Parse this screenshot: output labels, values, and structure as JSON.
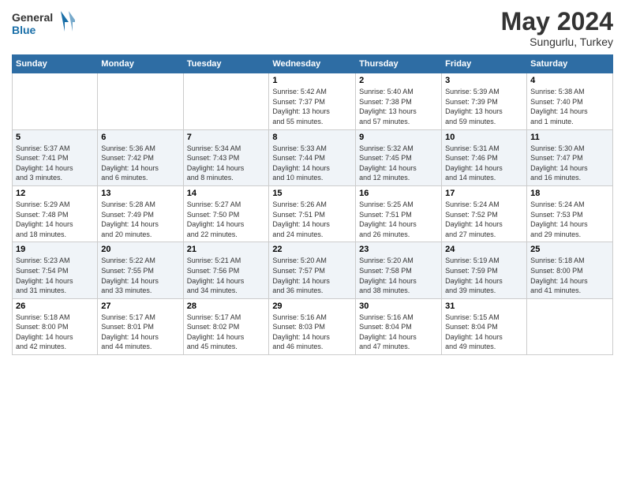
{
  "header": {
    "logo_general": "General",
    "logo_blue": "Blue",
    "month_title": "May 2024",
    "subtitle": "Sungurlu, Turkey"
  },
  "weekdays": [
    "Sunday",
    "Monday",
    "Tuesday",
    "Wednesday",
    "Thursday",
    "Friday",
    "Saturday"
  ],
  "rows": [
    [
      {
        "day": "",
        "info": ""
      },
      {
        "day": "",
        "info": ""
      },
      {
        "day": "",
        "info": ""
      },
      {
        "day": "1",
        "info": "Sunrise: 5:42 AM\nSunset: 7:37 PM\nDaylight: 13 hours\nand 55 minutes."
      },
      {
        "day": "2",
        "info": "Sunrise: 5:40 AM\nSunset: 7:38 PM\nDaylight: 13 hours\nand 57 minutes."
      },
      {
        "day": "3",
        "info": "Sunrise: 5:39 AM\nSunset: 7:39 PM\nDaylight: 13 hours\nand 59 minutes."
      },
      {
        "day": "4",
        "info": "Sunrise: 5:38 AM\nSunset: 7:40 PM\nDaylight: 14 hours\nand 1 minute."
      }
    ],
    [
      {
        "day": "5",
        "info": "Sunrise: 5:37 AM\nSunset: 7:41 PM\nDaylight: 14 hours\nand 3 minutes."
      },
      {
        "day": "6",
        "info": "Sunrise: 5:36 AM\nSunset: 7:42 PM\nDaylight: 14 hours\nand 6 minutes."
      },
      {
        "day": "7",
        "info": "Sunrise: 5:34 AM\nSunset: 7:43 PM\nDaylight: 14 hours\nand 8 minutes."
      },
      {
        "day": "8",
        "info": "Sunrise: 5:33 AM\nSunset: 7:44 PM\nDaylight: 14 hours\nand 10 minutes."
      },
      {
        "day": "9",
        "info": "Sunrise: 5:32 AM\nSunset: 7:45 PM\nDaylight: 14 hours\nand 12 minutes."
      },
      {
        "day": "10",
        "info": "Sunrise: 5:31 AM\nSunset: 7:46 PM\nDaylight: 14 hours\nand 14 minutes."
      },
      {
        "day": "11",
        "info": "Sunrise: 5:30 AM\nSunset: 7:47 PM\nDaylight: 14 hours\nand 16 minutes."
      }
    ],
    [
      {
        "day": "12",
        "info": "Sunrise: 5:29 AM\nSunset: 7:48 PM\nDaylight: 14 hours\nand 18 minutes."
      },
      {
        "day": "13",
        "info": "Sunrise: 5:28 AM\nSunset: 7:49 PM\nDaylight: 14 hours\nand 20 minutes."
      },
      {
        "day": "14",
        "info": "Sunrise: 5:27 AM\nSunset: 7:50 PM\nDaylight: 14 hours\nand 22 minutes."
      },
      {
        "day": "15",
        "info": "Sunrise: 5:26 AM\nSunset: 7:51 PM\nDaylight: 14 hours\nand 24 minutes."
      },
      {
        "day": "16",
        "info": "Sunrise: 5:25 AM\nSunset: 7:51 PM\nDaylight: 14 hours\nand 26 minutes."
      },
      {
        "day": "17",
        "info": "Sunrise: 5:24 AM\nSunset: 7:52 PM\nDaylight: 14 hours\nand 27 minutes."
      },
      {
        "day": "18",
        "info": "Sunrise: 5:24 AM\nSunset: 7:53 PM\nDaylight: 14 hours\nand 29 minutes."
      }
    ],
    [
      {
        "day": "19",
        "info": "Sunrise: 5:23 AM\nSunset: 7:54 PM\nDaylight: 14 hours\nand 31 minutes."
      },
      {
        "day": "20",
        "info": "Sunrise: 5:22 AM\nSunset: 7:55 PM\nDaylight: 14 hours\nand 33 minutes."
      },
      {
        "day": "21",
        "info": "Sunrise: 5:21 AM\nSunset: 7:56 PM\nDaylight: 14 hours\nand 34 minutes."
      },
      {
        "day": "22",
        "info": "Sunrise: 5:20 AM\nSunset: 7:57 PM\nDaylight: 14 hours\nand 36 minutes."
      },
      {
        "day": "23",
        "info": "Sunrise: 5:20 AM\nSunset: 7:58 PM\nDaylight: 14 hours\nand 38 minutes."
      },
      {
        "day": "24",
        "info": "Sunrise: 5:19 AM\nSunset: 7:59 PM\nDaylight: 14 hours\nand 39 minutes."
      },
      {
        "day": "25",
        "info": "Sunrise: 5:18 AM\nSunset: 8:00 PM\nDaylight: 14 hours\nand 41 minutes."
      }
    ],
    [
      {
        "day": "26",
        "info": "Sunrise: 5:18 AM\nSunset: 8:00 PM\nDaylight: 14 hours\nand 42 minutes."
      },
      {
        "day": "27",
        "info": "Sunrise: 5:17 AM\nSunset: 8:01 PM\nDaylight: 14 hours\nand 44 minutes."
      },
      {
        "day": "28",
        "info": "Sunrise: 5:17 AM\nSunset: 8:02 PM\nDaylight: 14 hours\nand 45 minutes."
      },
      {
        "day": "29",
        "info": "Sunrise: 5:16 AM\nSunset: 8:03 PM\nDaylight: 14 hours\nand 46 minutes."
      },
      {
        "day": "30",
        "info": "Sunrise: 5:16 AM\nSunset: 8:04 PM\nDaylight: 14 hours\nand 47 minutes."
      },
      {
        "day": "31",
        "info": "Sunrise: 5:15 AM\nSunset: 8:04 PM\nDaylight: 14 hours\nand 49 minutes."
      },
      {
        "day": "",
        "info": ""
      }
    ]
  ]
}
